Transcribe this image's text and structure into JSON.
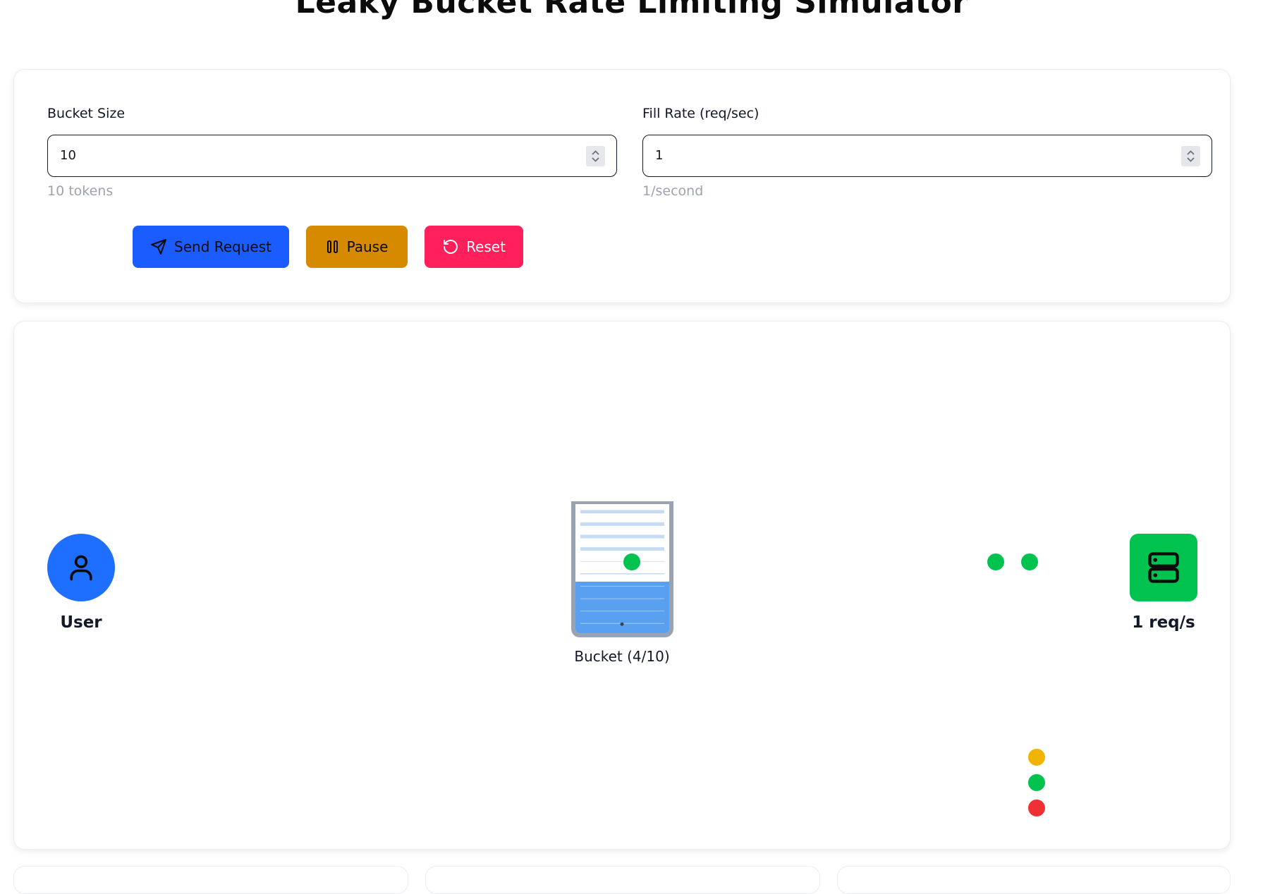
{
  "page": {
    "title": "Leaky Bucket Rate Limiting Simulator"
  },
  "controls": {
    "bucket_size": {
      "label": "Bucket Size",
      "value": "10",
      "hint": "10 tokens"
    },
    "fill_rate": {
      "label": "Fill Rate (req/sec)",
      "value": "1",
      "hint": "1/second"
    },
    "buttons": {
      "send": "Send Request",
      "pause": "Pause",
      "reset": "Reset"
    }
  },
  "simulation": {
    "user_label": "User",
    "bucket_label": "Bucket (4/10)",
    "bucket_fill_fraction": 0.4,
    "server_label": "1 req/s",
    "legend_dot_colors": [
      "#f0b400",
      "#00c24f",
      "#f03035"
    ]
  },
  "colors": {
    "primary": "#1a5cff",
    "warning": "#d68a00",
    "danger": "#ff1f5a",
    "success": "#00c24f",
    "user": "#1e6fff",
    "water": "#5aa0f0"
  }
}
